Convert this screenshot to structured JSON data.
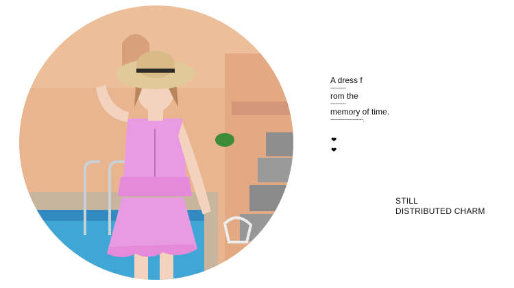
{
  "photo": {
    "colors": {
      "wall": "#E9B590",
      "water": "#3FA6D6",
      "dress": "#E99BE2",
      "hat": "#E2C99A",
      "skin": "#F3D2BE"
    }
  },
  "text": {
    "lines": [
      "A dress f",
      "rom the",
      "memory of time."
    ],
    "dashes": [
      "---------",
      "---------",
      "-------------------."
    ],
    "hearts": [
      "❤",
      "❤"
    ],
    "charm": [
      "STILL",
      "DISTRIBUTED CHARM"
    ]
  }
}
